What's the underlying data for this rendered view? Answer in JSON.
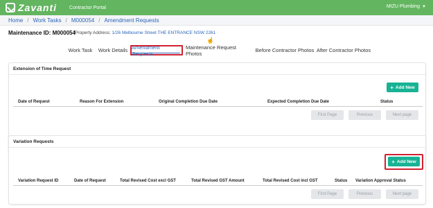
{
  "header": {
    "logo_text": "Zavanti",
    "portal_label": "Contractor Portal",
    "user_label": "MIZU Plumbing",
    "brand_color": "#63b560"
  },
  "breadcrumb": [
    "Home",
    "Work Tasks",
    "M000054",
    "Amendment Requests"
  ],
  "maintenance": {
    "id_text": "Maintenance ID: M000054",
    "address_label": "Property Address:",
    "address_value": "1/26 Melbourne Street THE ENTRANCE NSW 2261"
  },
  "tabs": [
    {
      "label": "Work Task",
      "active": false
    },
    {
      "label": "Work Details",
      "active": false
    },
    {
      "label": "Amendment Requests",
      "active": true
    },
    {
      "label": "Maintenance Request Photos",
      "active": false
    },
    {
      "label": "Before Contractor Photos",
      "active": false
    },
    {
      "label": "After Contractor Photos",
      "active": false
    }
  ],
  "extension_section": {
    "title": "Extension of Time Request",
    "add_button": "Add New",
    "columns": [
      "Date of Request",
      "Reason For Extension",
      "Original Completion Due Date",
      "Expected Completion Due Date",
      "Status"
    ],
    "pager": [
      "First Page",
      "Previous",
      "Next page"
    ]
  },
  "variation_section": {
    "title": "Variation Requests",
    "add_button": "Add New",
    "columns": [
      "Variation Request ID",
      "Date of Request",
      "Total Revised Cost excl GST",
      "Total Revised GST Amount",
      "Total Revised Cost incl GST",
      "Status",
      "Variation Approval Status"
    ],
    "pager": [
      "First Page",
      "Previous",
      "Next page"
    ]
  },
  "colors": {
    "accent_button": "#17b394",
    "highlight_frame": "#d0202f",
    "link": "#2c65b8"
  }
}
